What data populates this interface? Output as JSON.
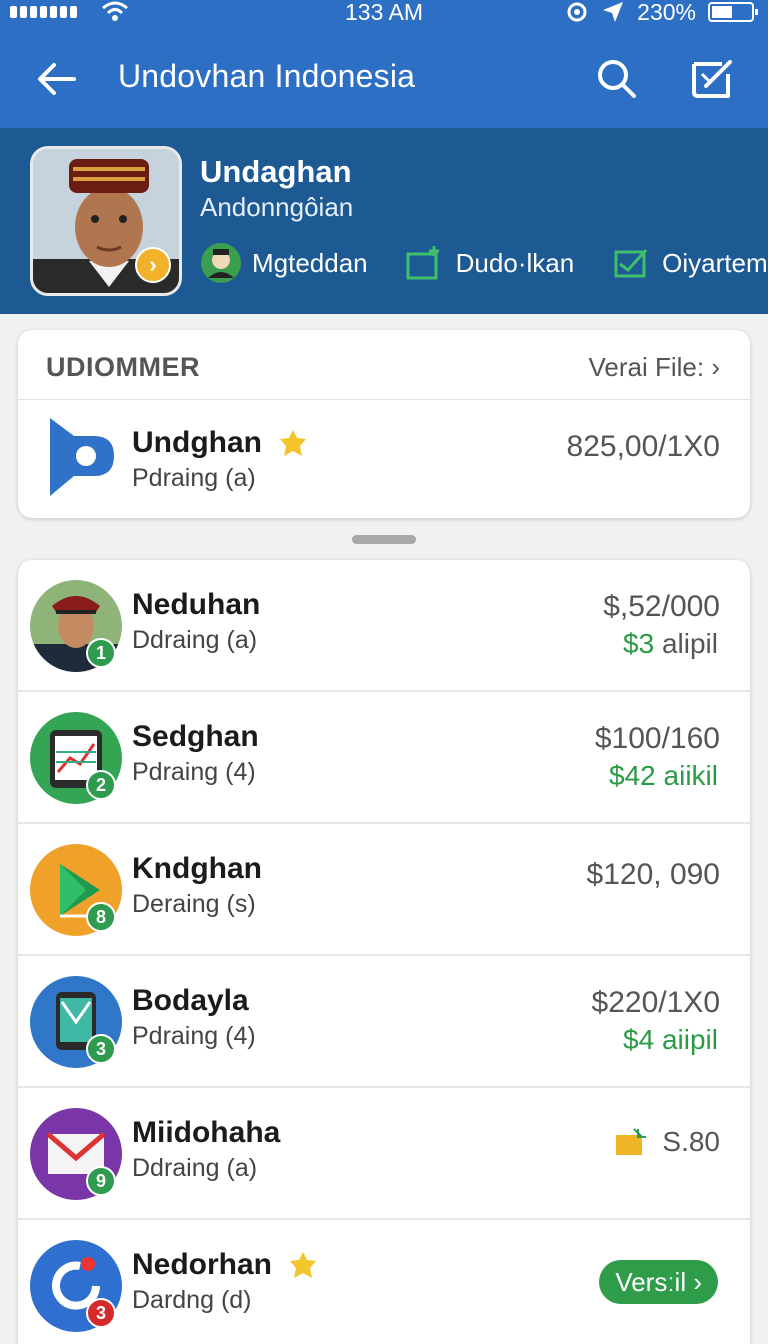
{
  "status": {
    "time": "133 AM",
    "battery": "230%"
  },
  "appbar": {
    "title": "Undovhan Indonesia"
  },
  "profile": {
    "name": "Undaghan",
    "subtitle": "Andonngôian",
    "actions": [
      {
        "label": "Mgteddan",
        "icon": "contact-avatar-icon"
      },
      {
        "label": "Dudo·lkan",
        "icon": "folder-plus-icon"
      },
      {
        "label": "Oiyartem",
        "icon": "check-box-icon"
      }
    ]
  },
  "section": {
    "label": "UDIOMMER",
    "link": "Verai File: ›",
    "featured": {
      "title": "Undghan",
      "subtitle": "Pdraing (a)",
      "price": "825,00/1X0"
    }
  },
  "list": [
    {
      "title": "Neduhan",
      "subtitle": "Ddraing (a)",
      "price": "$,52/000",
      "change_value": "$3",
      "change_text": "alipil",
      "badge": "1"
    },
    {
      "title": "Sedghan",
      "subtitle": "Pdraing (4)",
      "price": "$100/160",
      "change_value": "$42",
      "change_text": "aiikil",
      "badge": "2"
    },
    {
      "title": "Kndghan",
      "subtitle": "Deraing (s)",
      "price": "$120, 090",
      "badge": "8"
    },
    {
      "title": "Bodayla",
      "subtitle": "Pdraing (4)",
      "price": "$220/1X0",
      "change_value": "$4",
      "change_text": "aiipil",
      "badge": "3"
    },
    {
      "title": "Miidohaha",
      "subtitle": "Ddraing (a)",
      "price": "S.80",
      "badge": "9"
    },
    {
      "title": "Nedorhan",
      "subtitle": "Dardng (d)",
      "button": "Versːil ›",
      "badge": "3"
    }
  ],
  "colors": {
    "primary": "#2d6fc4",
    "header": "#1d5a93",
    "positive": "#2b9a44"
  }
}
